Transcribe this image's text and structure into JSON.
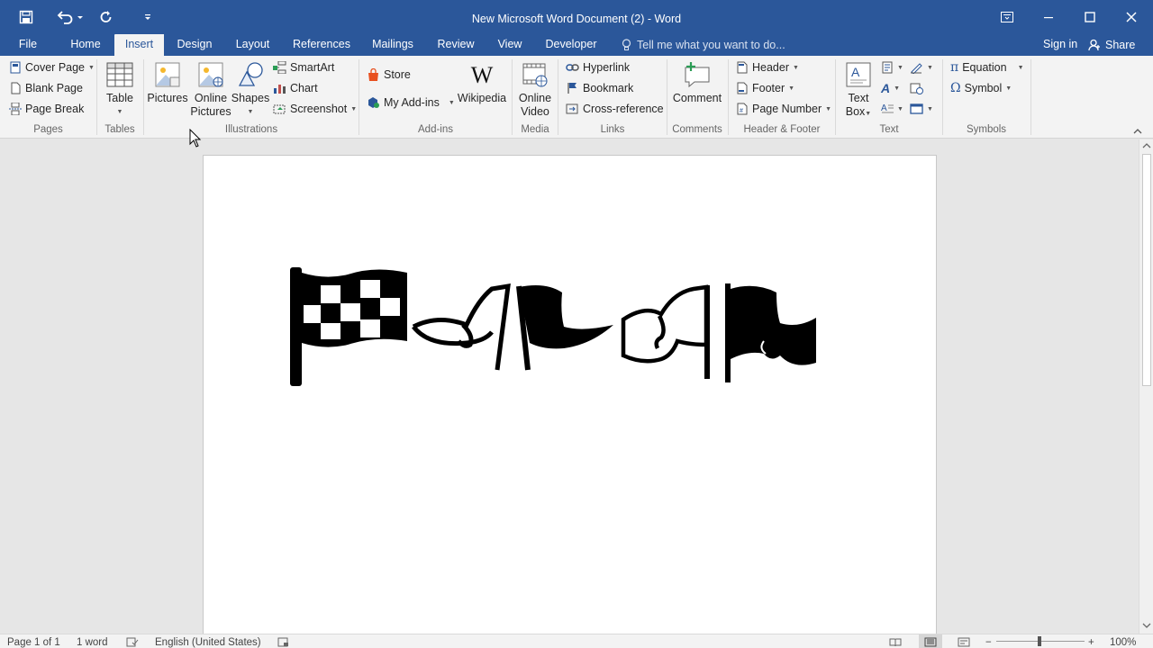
{
  "window": {
    "title": "New Microsoft Word Document (2) - Word",
    "accent": "#2b579a"
  },
  "quick_access": [
    "save-icon",
    "undo-icon",
    "redo-icon",
    "customize-qat-icon"
  ],
  "tabs": [
    {
      "label": "File"
    },
    {
      "label": "Home"
    },
    {
      "label": "Insert"
    },
    {
      "label": "Design"
    },
    {
      "label": "Layout"
    },
    {
      "label": "References"
    },
    {
      "label": "Mailings"
    },
    {
      "label": "Review"
    },
    {
      "label": "View"
    },
    {
      "label": "Developer"
    }
  ],
  "tell_me": "Tell me what you want to do...",
  "sign_in": "Sign in",
  "share": "Share",
  "ribbon": {
    "pages": {
      "label": "Pages",
      "cover_page": "Cover Page",
      "blank_page": "Blank Page",
      "page_break": "Page Break"
    },
    "tables": {
      "label": "Tables",
      "table": "Table"
    },
    "illustrations": {
      "label": "Illustrations",
      "pictures": "Pictures",
      "online_pictures_1": "Online",
      "online_pictures_2": "Pictures",
      "shapes": "Shapes",
      "smartart": "SmartArt",
      "chart": "Chart",
      "screenshot": "Screenshot"
    },
    "addins": {
      "label": "Add-ins",
      "store": "Store",
      "my_addins": "My Add-ins",
      "wikipedia": "Wikipedia"
    },
    "media": {
      "label": "Media",
      "online_video_1": "Online",
      "online_video_2": "Video"
    },
    "links": {
      "label": "Links",
      "hyperlink": "Hyperlink",
      "bookmark": "Bookmark",
      "cross_reference": "Cross-reference"
    },
    "comments": {
      "label": "Comments",
      "comment": "Comment"
    },
    "header_footer": {
      "label": "Header & Footer",
      "header": "Header",
      "footer": "Footer",
      "page_number": "Page Number"
    },
    "text": {
      "label": "Text",
      "text_box_1": "Text",
      "text_box_2": "Box"
    },
    "symbols": {
      "label": "Symbols",
      "equation": "Equation",
      "symbol": "Symbol"
    }
  },
  "document": {
    "content_icons": [
      "checkered-flag-icon",
      "waving-flags-outline-icon",
      "black-flag-icon",
      "white-flag-outline-icon",
      "black-waving-flag-icon"
    ]
  },
  "status": {
    "page": "Page 1 of 1",
    "words": "1 word",
    "language": "English (United States)",
    "zoom": "100%"
  }
}
